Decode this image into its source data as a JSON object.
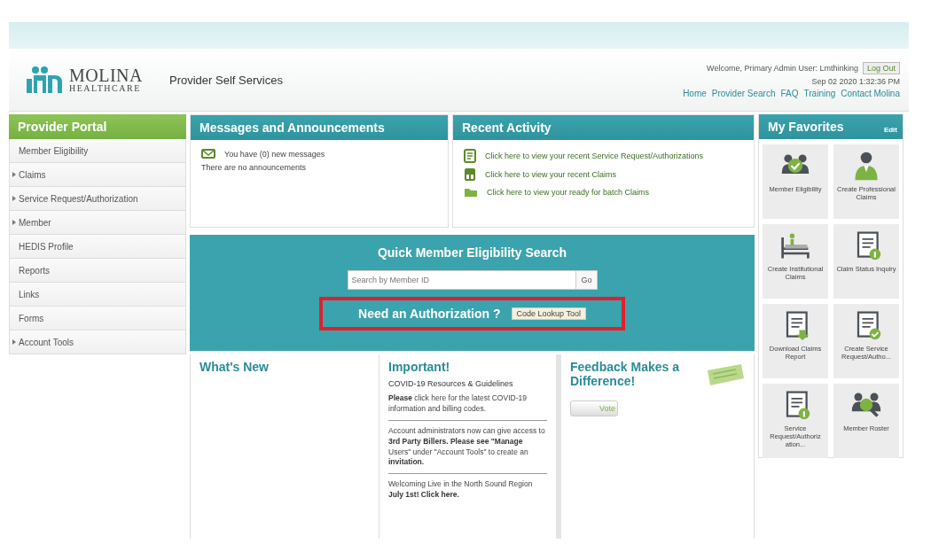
{
  "header": {
    "logo_name": "MOLINA",
    "logo_sub": "HEALTHCARE",
    "site_title": "Provider Self Services",
    "welcome": "Welcome, Primary Admin User: Lmthinking",
    "logout": "Log Out",
    "datetime": "Sep 02 2020 1:32:36 PM",
    "links": [
      "Home",
      "Provider Search",
      "FAQ",
      "Training",
      "Contact Molina"
    ]
  },
  "sidebar": {
    "title": "Provider Portal",
    "items": [
      {
        "label": "Member Eligibility",
        "has_submenu": false
      },
      {
        "label": "Claims",
        "has_submenu": true
      },
      {
        "label": "Service Request/Authorization",
        "has_submenu": true
      },
      {
        "label": "Member",
        "has_submenu": true
      },
      {
        "label": "HEDIS Profile",
        "has_submenu": false
      },
      {
        "label": "Reports",
        "has_submenu": false
      },
      {
        "label": "Links",
        "has_submenu": false
      },
      {
        "label": "Forms",
        "has_submenu": false
      },
      {
        "label": "Account Tools",
        "has_submenu": true
      }
    ]
  },
  "messages": {
    "title": "Messages and Announcements",
    "new_messages": "You have (0) new messages",
    "announcements": "There are no announcements"
  },
  "recent_activity": {
    "title": "Recent Activity",
    "items": [
      {
        "kind": "document",
        "label": "Click here to view your recent Service Request/Authorizations"
      },
      {
        "kind": "claims",
        "label": "Click here to view your recent Claims"
      },
      {
        "kind": "folder",
        "label": "Click here to view your ready for batch Claims"
      }
    ]
  },
  "quick_search": {
    "title": "Quick Member Eligibility Search",
    "placeholder": "Search by Member ID",
    "go": "Go",
    "auth_prompt": "Need an Authorization ?",
    "auth_button": "Code Lookup Tool"
  },
  "whats_new": {
    "title": "What's New"
  },
  "important": {
    "title": "Important!",
    "subtitle": "COVID-19 Resources & Guidelines",
    "paragraphs": [
      "**Please** click here for the latest COVID-19 information and billing codes.",
      "Account administrators now can give access to **3rd Party Billers. Please see \"Manage** Users\" under \"Account Tools\" to create an **invitation.**",
      "Welcoming Live in the North Sound Region **July 1st! Click here.**"
    ]
  },
  "feedback": {
    "title": "Feedback Makes a Difference!",
    "button": "Vote"
  },
  "favorites": {
    "title": "My Favorites",
    "edit": "Edit",
    "tiles": [
      {
        "kind": "member-check",
        "label": "Member Eligibility"
      },
      {
        "kind": "doctor",
        "label": "Create Professional Claims"
      },
      {
        "kind": "bed",
        "label": "Create Institutional Claims"
      },
      {
        "kind": "doc-info",
        "label": "Claim Status Inquiry"
      },
      {
        "kind": "doc-download",
        "label": "Download Claims Report"
      },
      {
        "kind": "doc-check",
        "label": "Create Service Request/Autho..."
      },
      {
        "kind": "doc-info",
        "label": "Service Request/Authoriz ation..."
      },
      {
        "kind": "member-search",
        "label": "Member Roster"
      }
    ]
  }
}
